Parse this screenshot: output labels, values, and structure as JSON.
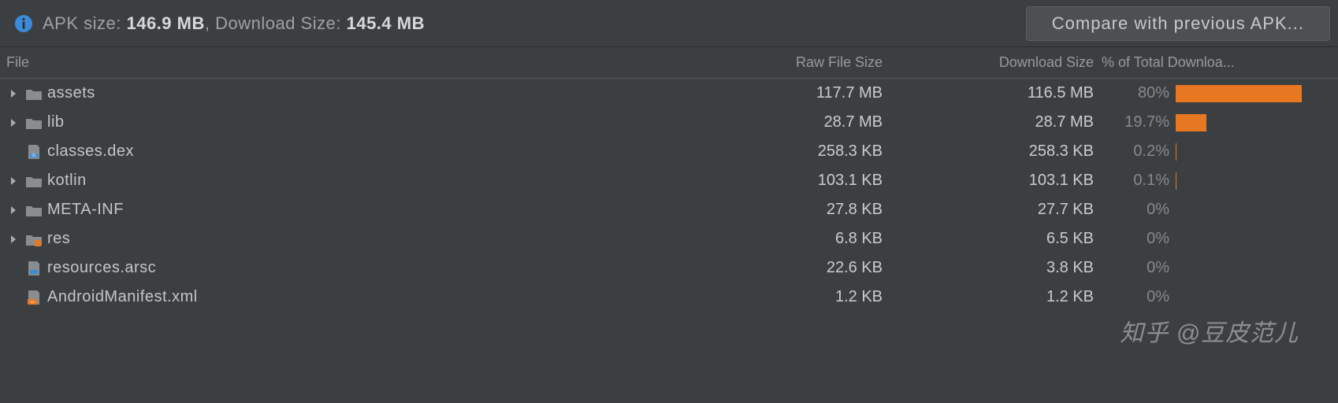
{
  "header": {
    "apk_label": "APK size: ",
    "apk_size_value": "146.9 MB",
    "separator": ", ",
    "download_label": "Download Size: ",
    "download_size_value": "145.4 MB",
    "compare_button": "Compare with previous APK..."
  },
  "columns": {
    "file": "File",
    "raw": "Raw File Size",
    "download": "Download Size",
    "percent": "% of Total Downloa..."
  },
  "rows": [
    {
      "name": "assets",
      "icon": "folder",
      "expandable": true,
      "raw_size": "117.7 MB",
      "download_size": "116.5 MB",
      "percent_label": "80%",
      "percent_value": 80
    },
    {
      "name": "lib",
      "icon": "folder",
      "expandable": true,
      "raw_size": "28.7 MB",
      "download_size": "28.7 MB",
      "percent_label": "19.7%",
      "percent_value": 19.7
    },
    {
      "name": "classes.dex",
      "icon": "file-dex",
      "expandable": false,
      "raw_size": "258.3 KB",
      "download_size": "258.3 KB",
      "percent_label": "0.2%",
      "percent_value": 0.2
    },
    {
      "name": "kotlin",
      "icon": "folder",
      "expandable": true,
      "raw_size": "103.1 KB",
      "download_size": "103.1 KB",
      "percent_label": "0.1%",
      "percent_value": 0.1
    },
    {
      "name": "META-INF",
      "icon": "folder",
      "expandable": true,
      "raw_size": "27.8 KB",
      "download_size": "27.7 KB",
      "percent_label": "0%",
      "percent_value": 0
    },
    {
      "name": "res",
      "icon": "folder-res",
      "expandable": true,
      "raw_size": "6.8 KB",
      "download_size": "6.5 KB",
      "percent_label": "0%",
      "percent_value": 0
    },
    {
      "name": "resources.arsc",
      "icon": "file-arsc",
      "expandable": false,
      "raw_size": "22.6 KB",
      "download_size": "3.8 KB",
      "percent_label": "0%",
      "percent_value": 0
    },
    {
      "name": "AndroidManifest.xml",
      "icon": "file-manifest",
      "expandable": false,
      "raw_size": "1.2 KB",
      "download_size": "1.2 KB",
      "percent_label": "0%",
      "percent_value": 0
    }
  ],
  "watermark": "知乎 @豆皮范儿"
}
